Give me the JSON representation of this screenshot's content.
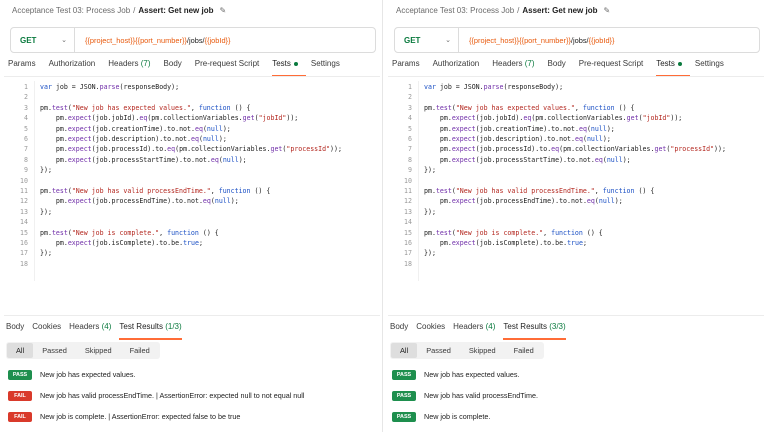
{
  "panels": [
    {
      "breadcrumb": {
        "parent": "Acceptance Test 03: Process Job",
        "current": "Assert: Get new job"
      },
      "request": {
        "method": "GET",
        "url_parts": [
          {
            "text": "{{project_host}}{{port_number}}",
            "kind": "var"
          },
          {
            "text": "/jobs/",
            "kind": "plain"
          },
          {
            "text": "{{jobId}}",
            "kind": "var"
          }
        ]
      },
      "request_tabs": [
        {
          "label": "Params",
          "count": ""
        },
        {
          "label": "Authorization",
          "count": ""
        },
        {
          "label": "Headers",
          "count": "(7)"
        },
        {
          "label": "Body",
          "count": ""
        },
        {
          "label": "Pre-request Script",
          "count": ""
        },
        {
          "label": "Tests",
          "count": "",
          "active": true,
          "dot": true
        },
        {
          "label": "Settings",
          "count": ""
        }
      ],
      "code_lines": [
        "var job = JSON.parse(responseBody);",
        "",
        "pm.test(\"New job has expected values.\", function () {",
        "    pm.expect(job.jobId).eq(pm.collectionVariables.get(\"jobId\"));",
        "    pm.expect(job.creationTime).to.not.eq(null);",
        "    pm.expect(job.description).to.not.eq(null);",
        "    pm.expect(job.processId).to.eq(pm.collectionVariables.get(\"processId\"));",
        "    pm.expect(job.processStartTime).to.not.eq(null);",
        "});",
        "",
        "pm.test(\"New job has valid processEndTime.\", function () {",
        "    pm.expect(job.processEndTime).to.not.eq(null);",
        "});",
        "",
        "pm.test(\"New job is complete.\", function () {",
        "    pm.expect(job.isComplete).to.be.true;",
        "});",
        ""
      ],
      "response_tabs": [
        {
          "label": "Body",
          "count": ""
        },
        {
          "label": "Cookies",
          "count": ""
        },
        {
          "label": "Headers",
          "count": "(4)"
        },
        {
          "label": "Test Results",
          "count": "(1/3)",
          "active": true
        }
      ],
      "filters": [
        "All",
        "Passed",
        "Skipped",
        "Failed"
      ],
      "results": [
        {
          "status": "PASS",
          "text": "New job has expected values."
        },
        {
          "status": "FAIL",
          "text": "New job has valid processEndTime. | AssertionError: expected null to not equal null"
        },
        {
          "status": "FAIL",
          "text": "New job is complete. | AssertionError: expected false to be true"
        }
      ]
    },
    {
      "breadcrumb": {
        "parent": "Acceptance Test 03: Process Job",
        "current": "Assert: Get new job"
      },
      "request": {
        "method": "GET",
        "url_parts": [
          {
            "text": "{{project_host}}{{port_number}}",
            "kind": "var"
          },
          {
            "text": "/jobs/",
            "kind": "plain"
          },
          {
            "text": "{{jobId}}",
            "kind": "var"
          }
        ]
      },
      "request_tabs": [
        {
          "label": "Params",
          "count": ""
        },
        {
          "label": "Authorization",
          "count": ""
        },
        {
          "label": "Headers",
          "count": "(7)"
        },
        {
          "label": "Body",
          "count": ""
        },
        {
          "label": "Pre-request Script",
          "count": ""
        },
        {
          "label": "Tests",
          "count": "",
          "active": true,
          "dot": true
        },
        {
          "label": "Settings",
          "count": ""
        }
      ],
      "code_lines": [
        "var job = JSON.parse(responseBody);",
        "",
        "pm.test(\"New job has expected values.\", function () {",
        "    pm.expect(job.jobId).eq(pm.collectionVariables.get(\"jobId\"));",
        "    pm.expect(job.creationTime).to.not.eq(null);",
        "    pm.expect(job.description).to.not.eq(null);",
        "    pm.expect(job.processId).to.eq(pm.collectionVariables.get(\"processId\"));",
        "    pm.expect(job.processStartTime).to.not.eq(null);",
        "});",
        "",
        "pm.test(\"New job has valid processEndTime.\", function () {",
        "    pm.expect(job.processEndTime).to.not.eq(null);",
        "});",
        "",
        "pm.test(\"New job is complete.\", function () {",
        "    pm.expect(job.isComplete).to.be.true;",
        "});",
        ""
      ],
      "response_tabs": [
        {
          "label": "Body",
          "count": ""
        },
        {
          "label": "Cookies",
          "count": ""
        },
        {
          "label": "Headers",
          "count": "(4)"
        },
        {
          "label": "Test Results",
          "count": "(3/3)",
          "active": true
        }
      ],
      "filters": [
        "All",
        "Passed",
        "Skipped",
        "Failed"
      ],
      "results": [
        {
          "status": "PASS",
          "text": "New job has expected values."
        },
        {
          "status": "PASS",
          "text": "New job has valid processEndTime."
        },
        {
          "status": "PASS",
          "text": "New job is complete."
        }
      ]
    }
  ]
}
